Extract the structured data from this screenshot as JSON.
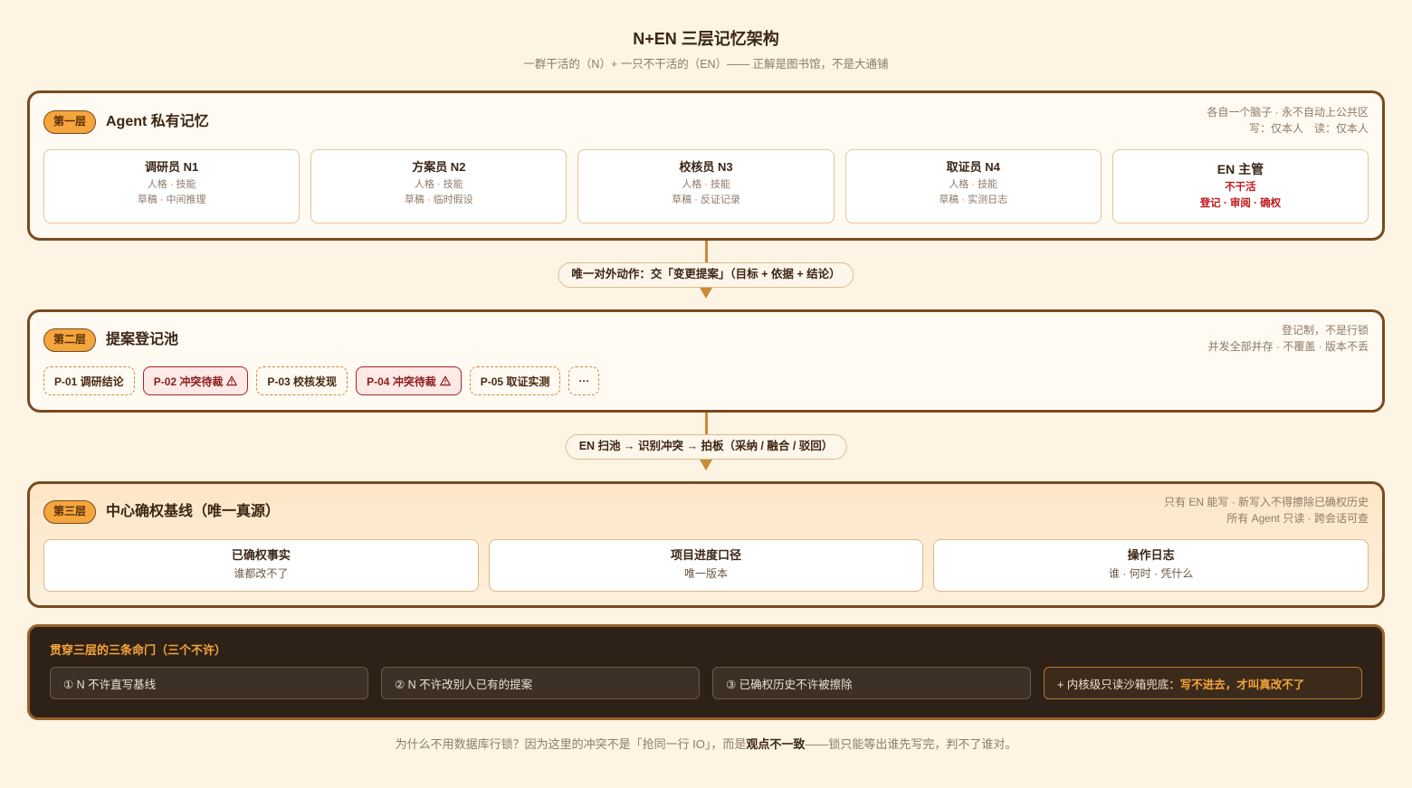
{
  "header": {
    "title": "N+EN 三层记忆架构",
    "subtitle": "一群干活的（N）+ 一只不干活的（EN）—— 正解是图书馆，不是大通铺"
  },
  "layer1": {
    "badge": "第一层",
    "title": "Agent 私有记忆",
    "notes": [
      "各自一个脑子 · 永不自动上公共区",
      "写：仅本人　读：仅本人"
    ],
    "cards": [
      {
        "title": "调研员 N1",
        "line1": "人格 · 技能",
        "line2": "草稿 · 中间推理"
      },
      {
        "title": "方案员 N2",
        "line1": "人格 · 技能",
        "line2": "草稿 · 临时假设"
      },
      {
        "title": "校核员 N3",
        "line1": "人格 · 技能",
        "line2": "草稿 · 反证记录"
      },
      {
        "title": "取证员 N4",
        "line1": "人格 · 技能",
        "line2": "草稿 · 实测日志"
      },
      {
        "title": "EN 主管",
        "line1": "不干活",
        "line2": "登记 · 审阅 · 确权"
      }
    ]
  },
  "flow1": {
    "label": "唯一对外动作：交「变更提案」（目标 + 依据 + 结论）",
    "icon": "arrow-down-icon"
  },
  "layer2": {
    "badge": "第二层",
    "title": "提案登记池",
    "notes": [
      "登记制，不是行锁",
      "并发全部并存 · 不覆盖 · 版本不丢"
    ],
    "proposals": [
      {
        "label": "P-01 调研结论"
      },
      {
        "label": "P-02 冲突待裁",
        "icon": "warning-icon"
      },
      {
        "label": "P-03 校核发现"
      },
      {
        "label": "P-04 冲突待裁",
        "icon": "warning-icon"
      },
      {
        "label": "P-05 取证实测"
      },
      {
        "label": "···"
      }
    ]
  },
  "flow2": {
    "label": "EN 扫池 → 识别冲突 → 拍板（采纳 / 融合 / 驳回）",
    "icon": "arrow-down-icon"
  },
  "layer3": {
    "badge": "第三层",
    "title": "中心确权基线（唯一真源）",
    "notes": [
      "只有 EN 能写 · 新写入不得擦除已确权历史",
      "所有 Agent 只读 · 跨会话可查"
    ],
    "cards": [
      {
        "title": "已确权事实",
        "sub": "谁都改不了"
      },
      {
        "title": "项目进度口径",
        "sub": "唯一版本"
      },
      {
        "title": "操作日志",
        "sub": "谁 · 何时 · 凭什么"
      }
    ]
  },
  "rules": {
    "title": "贯穿三层的三条命门（三个不许）",
    "items": [
      {
        "text": "① N 不许直写基线"
      },
      {
        "text": "② N 不许改别人已有的提案"
      },
      {
        "text": "③ 已确权历史不许被擦除"
      },
      {
        "text": "+ 内核级只读沙箱兜底：",
        "highlight": "写不进去，才叫真改不了"
      }
    ]
  },
  "footer": {
    "before": "为什么不用数据库行锁？因为这里的冲突不是「抢同一行 IO」，而是",
    "emphasis": "观点不一致",
    "after": "——锁只能等出谁先写完，判不了谁对。"
  },
  "colors": {
    "background": "#fdf4e4",
    "text": "#3b2614",
    "muted_text": "#8d7b68",
    "frame": "#7a4a1f",
    "accent": "#f4a53c",
    "connector": "#c98a3a",
    "alert": "#c0191b",
    "dark_panel": "#2e2117"
  }
}
